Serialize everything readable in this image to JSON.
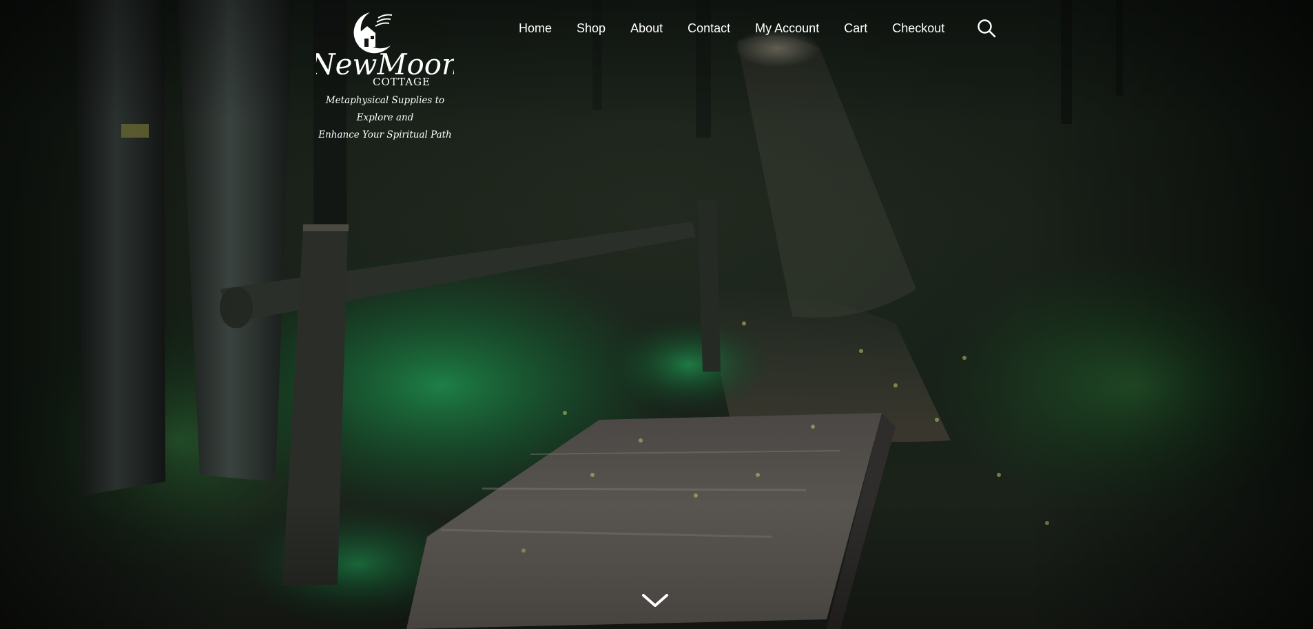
{
  "brand": {
    "logo_word_1": "NewMoon",
    "logo_word_2": "COTTAGE",
    "tagline_line_1": "Metaphysical Supplies to Explore and",
    "tagline_line_2": "Enhance Your Spiritual Path"
  },
  "nav": {
    "items": [
      {
        "label": "Home"
      },
      {
        "label": "Shop"
      },
      {
        "label": "About"
      },
      {
        "label": "Contact"
      },
      {
        "label": "My Account"
      },
      {
        "label": "Cart"
      },
      {
        "label": "Checkout"
      }
    ],
    "search_icon": "search-icon"
  },
  "hero": {
    "scroll_icon": "chevron-down-icon",
    "colors": {
      "foliage": "#1f7a45",
      "path": "#5e5a55",
      "trunk": "#2a302c",
      "nav_text": "#ffffff"
    }
  }
}
